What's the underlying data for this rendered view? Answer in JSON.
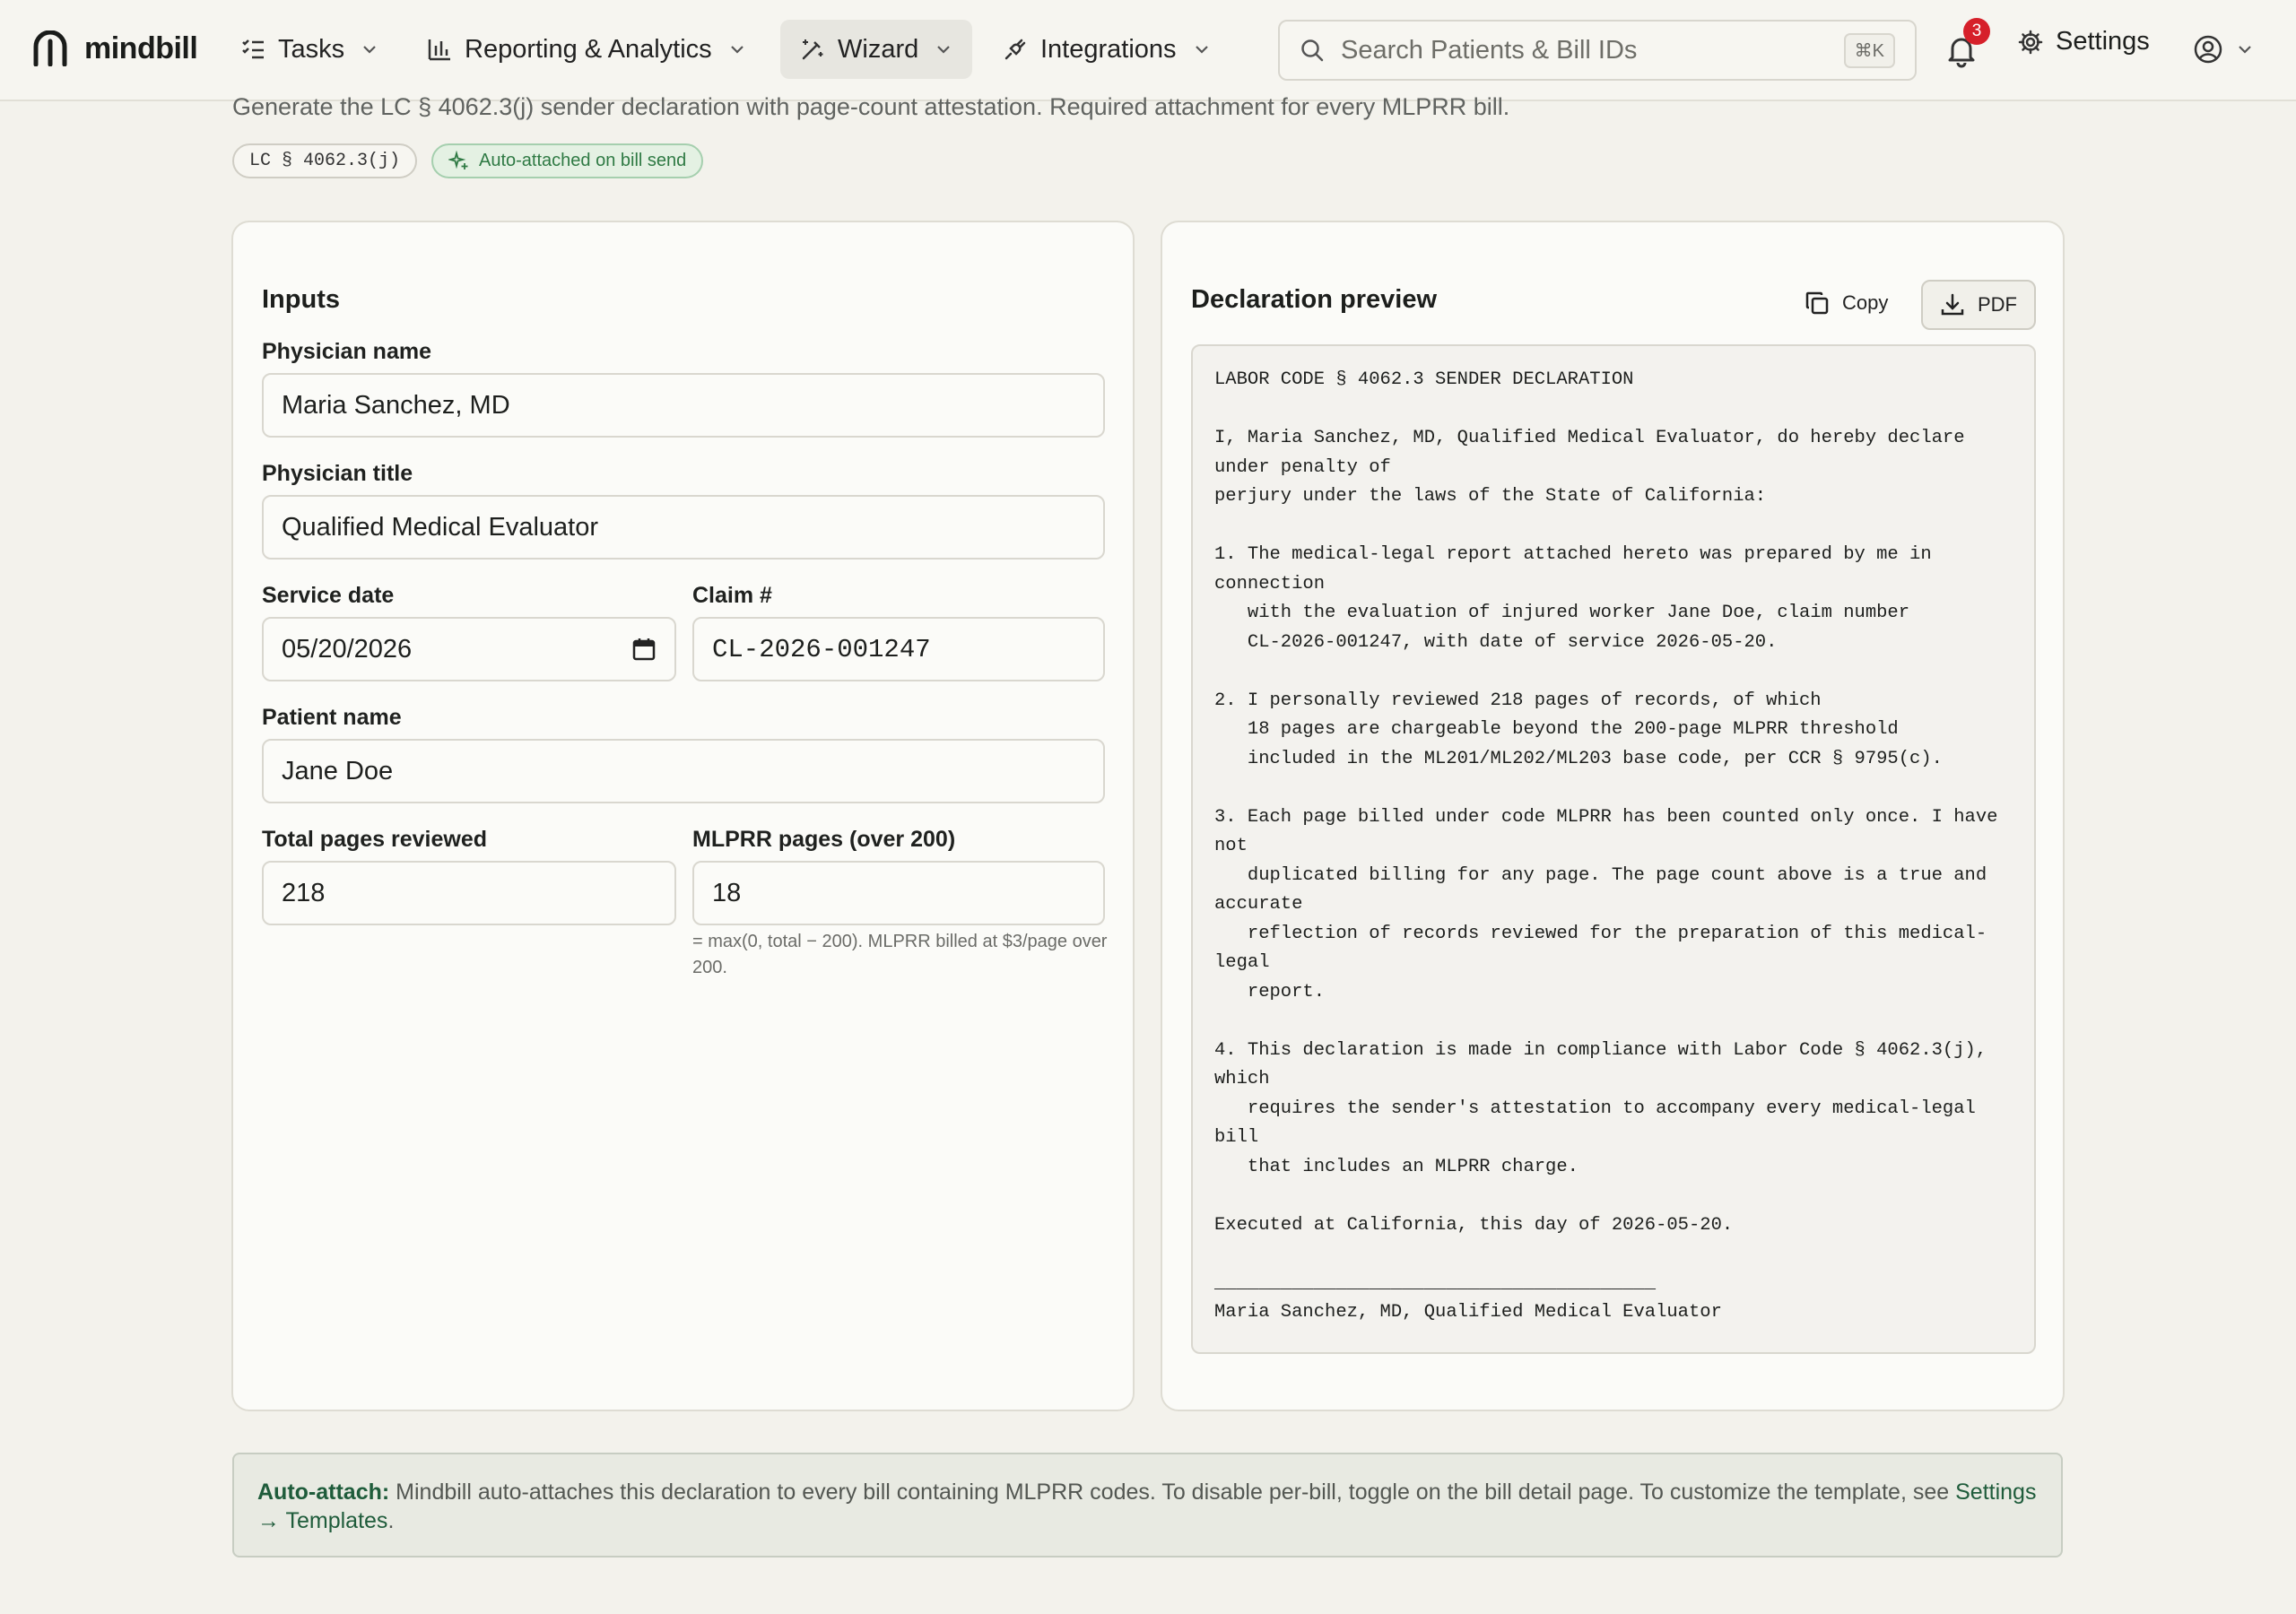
{
  "app": {
    "brand": "mindbill"
  },
  "nav": {
    "tasks": "Tasks",
    "reporting": "Reporting & Analytics",
    "wizard": "Wizard",
    "integrations": "Integrations"
  },
  "search": {
    "placeholder": "Search Patients & Bill IDs",
    "shortcut": "⌘K"
  },
  "notifications": {
    "count": "3"
  },
  "settings_label": "Settings",
  "header": {
    "subtitle": "Generate the LC § 4062.3(j) sender declaration with page-count attestation. Required attachment for every MLPRR bill.",
    "code_chip": "LC § 4062.3(j)",
    "auto_chip": "Auto-attached on bill send"
  },
  "inputs": {
    "title": "Inputs",
    "physician_name_label": "Physician name",
    "physician_name": "Maria Sanchez, MD",
    "physician_title_label": "Physician title",
    "physician_title": "Qualified Medical Evaluator",
    "service_date_label": "Service date",
    "service_date": "05/20/2026",
    "claim_label": "Claim #",
    "claim": "CL-2026-001247",
    "patient_label": "Patient name",
    "patient": "Jane Doe",
    "total_pages_label": "Total pages reviewed",
    "total_pages": "218",
    "mlprr_label": "MLPRR pages (over 200)",
    "mlprr_pages": "18",
    "mlprr_hint": "= max(0, total − 200). MLPRR billed at $3/page over 200."
  },
  "preview": {
    "title": "Declaration preview",
    "copy_label": "Copy",
    "pdf_label": "PDF",
    "text": "LABOR CODE § 4062.3 SENDER DECLARATION\n\nI, Maria Sanchez, MD, Qualified Medical Evaluator, do hereby declare\nunder penalty of\nperjury under the laws of the State of California:\n\n1. The medical-legal report attached hereto was prepared by me in\nconnection\n   with the evaluation of injured worker Jane Doe, claim number\n   CL-2026-001247, with date of service 2026-05-20.\n\n2. I personally reviewed 218 pages of records, of which\n   18 pages are chargeable beyond the 200-page MLPRR threshold\n   included in the ML201/ML202/ML203 base code, per CCR § 9795(c).\n\n3. Each page billed under code MLPRR has been counted only once. I have\nnot\n   duplicated billing for any page. The page count above is a true and\naccurate\n   reflection of records reviewed for the preparation of this medical-\nlegal\n   report.\n\n4. This declaration is made in compliance with Labor Code § 4062.3(j),\nwhich\n   requires the sender's attestation to accompany every medical-legal\nbill\n   that includes an MLPRR charge.\n\nExecuted at California, this day of 2026-05-20.\n\n________________________________________\nMaria Sanchez, MD, Qualified Medical Evaluator"
  },
  "note": {
    "label": "Auto-attach:",
    "text": " Mindbill auto-attaches this declaration to every bill containing MLPRR codes. To disable per-bill, toggle on the bill detail page. To customize the template, see ",
    "link": "Settings → Templates",
    "end": "."
  }
}
